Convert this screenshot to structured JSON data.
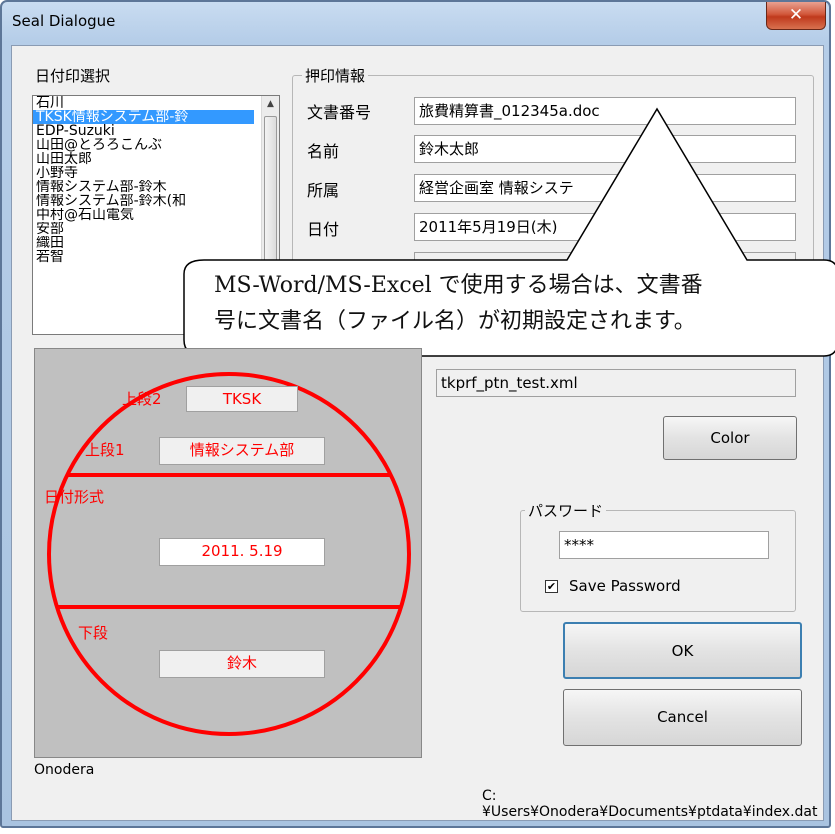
{
  "window": {
    "title": "Seal Dialogue",
    "close_glyph": "✕"
  },
  "date_stamp": {
    "group_label": "日付印選択",
    "items": [
      "石川",
      "TKSK情報システム部-鈴",
      "EDP-Suzuki",
      "山田@とろろこんぶ",
      "山田太郎",
      "小野寺",
      "情報システム部-鈴木",
      "情報システム部-鈴木(和",
      "中村@石山電気",
      "安部",
      "織田",
      "若智"
    ],
    "selected_index": 1
  },
  "stamp_info": {
    "group_label": "押印情報",
    "doc_number_label": "文書番号",
    "doc_number_value": "旅費精算書_012345a.doc",
    "name_label": "名前",
    "name_value": "鈴木太郎",
    "dept_label": "所属",
    "dept_value": "経営企画室 情報システ",
    "date_label": "日付",
    "date_value": "2011年5月19日(木)",
    "pattern_file": "tkprf_ptn_test.xml"
  },
  "callout": {
    "line1": "MS-Word/MS-Excel で使用する場合は、文書番",
    "line2": "号に文書名（ファイル名）が初期設定されます。"
  },
  "seal": {
    "color": "#ff0000",
    "upper2_label": "上段2",
    "upper2_value": "TKSK",
    "upper1_label": "上段1",
    "upper1_value": "情報システム部",
    "date_format_label": "日付形式",
    "date_value": "2011. 5.19",
    "lower_label": "下段",
    "lower_value": "鈴木"
  },
  "buttons": {
    "color": "Color",
    "ok": "OK",
    "cancel": "Cancel"
  },
  "password": {
    "group_label": "パスワード",
    "value": "****",
    "save_checked": true,
    "save_label": "Save Password",
    "check_glyph": "✔"
  },
  "status": {
    "user": "Onodera",
    "path": "C:¥Users¥Onodera¥Documents¥ptdata¥index.dat"
  }
}
